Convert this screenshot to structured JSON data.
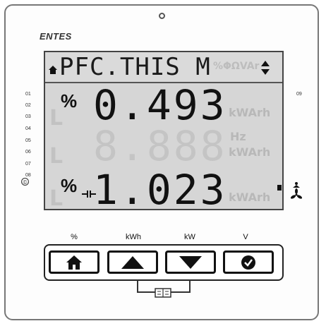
{
  "device": {
    "brand": "ENTES"
  },
  "lcd": {
    "title": "PFC.THIS M",
    "ghost_top": "%ΦΩVAr",
    "row1": {
      "unit": "%",
      "value": "0.493",
      "ghost_units": "kWArh"
    },
    "row2": {
      "ghost_value": "8.888",
      "ghost_unit_hz": "Hz",
      "ghost_units": "kWArh"
    },
    "row3": {
      "unit": "%",
      "value": "1.023",
      "ghost_units": "kWArh"
    },
    "ghost_L": "L"
  },
  "side_labels": [
    "01",
    "02",
    "03",
    "04",
    "05",
    "06",
    "07",
    "08"
  ],
  "right_label": "09",
  "buttons": [
    {
      "label": "%",
      "icon": "home-icon"
    },
    {
      "label": "kWh",
      "icon": "arrow-up-icon"
    },
    {
      "label": "kW",
      "icon": "arrow-down-icon"
    },
    {
      "label": "V",
      "icon": "check-icon"
    }
  ],
  "colors": {
    "lcd_background": "#d6d6d6",
    "segment_on": "#111111",
    "segment_off": "#c4c4c4"
  }
}
